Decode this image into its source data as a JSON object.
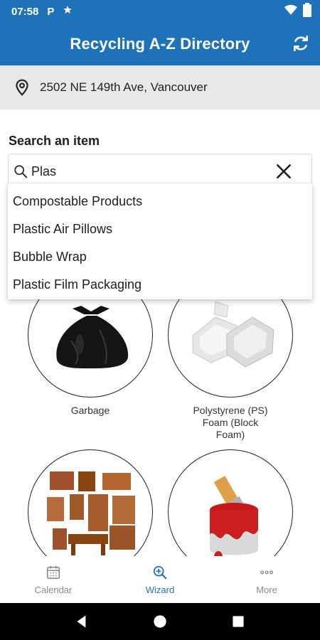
{
  "status_bar": {
    "time": "07:58",
    "icons": [
      "parking-icon",
      "star-icon",
      "wifi-icon",
      "battery-icon"
    ],
    "parking_label": "P"
  },
  "app_bar": {
    "title": "Recycling A-Z Directory",
    "refresh_icon": "refresh-icon"
  },
  "address": {
    "icon": "location-pin-icon",
    "text": "2502 NE 149th Ave, Vancouver"
  },
  "search": {
    "label": "Search an item",
    "value": "Plas",
    "clear_icon": "close-icon"
  },
  "suggestions": [
    "Compostable Products",
    "Plastic Air Pillows",
    "Bubble Wrap",
    "Plastic Film Packaging"
  ],
  "categories": [
    {
      "name": "Garbage",
      "image": "garbage-bag-image"
    },
    {
      "name_lines": [
        "Polystyrene (PS)",
        "Foam (Block",
        "Foam)"
      ],
      "image": "polystyrene-foam-image"
    },
    {
      "name": "",
      "image": "furniture-image"
    },
    {
      "name": "",
      "image": "paint-can-image"
    }
  ],
  "bottom_nav": {
    "tabs": [
      {
        "label": "Calendar",
        "icon": "calendar-icon",
        "active": false
      },
      {
        "label": "Wizard",
        "icon": "wizard-icon",
        "active": true
      },
      {
        "label": "More",
        "icon": "more-icon",
        "active": false
      }
    ]
  },
  "colors": {
    "primary": "#1e73b8",
    "address_bg": "#e8e8e8",
    "inactive_tab": "#8a8a8a"
  }
}
